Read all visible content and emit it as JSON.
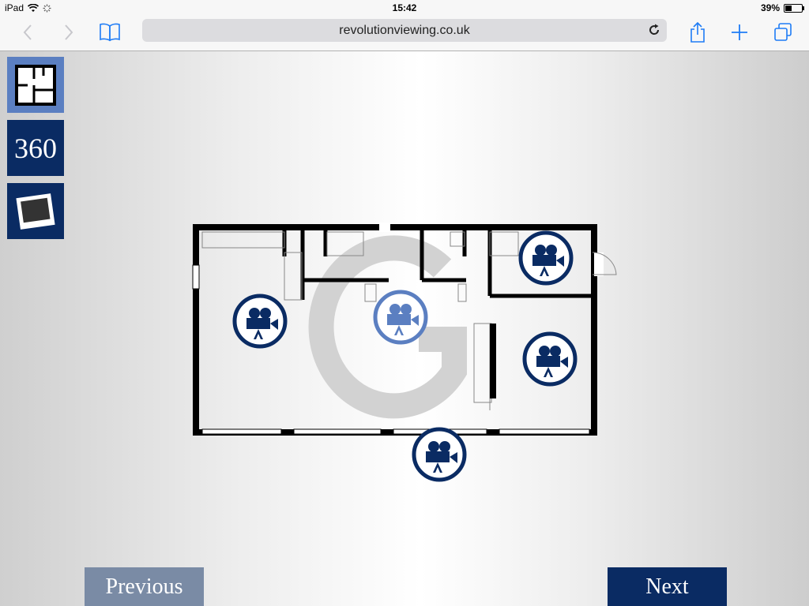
{
  "statusbar": {
    "device": "iPad",
    "time": "15:42",
    "battery_text": "39%",
    "battery_level": 0.39
  },
  "browser": {
    "url": "revolutionviewing.co.uk"
  },
  "icons": {
    "back": "chevron-left-icon",
    "forward": "chevron-right-icon",
    "bookmarks": "book-icon",
    "reload": "reload-icon",
    "share": "share-icon",
    "new_tab": "plus-icon",
    "tabs": "tabs-icon"
  },
  "sidebar": {
    "floorplan": "floorplan-icon",
    "pano_label": "360",
    "photo": "photo-icon"
  },
  "nav": {
    "previous_label": "Previous",
    "next_label": "Next"
  },
  "colors": {
    "navy": "#0a2b63",
    "light_blue": "#5b7fc1",
    "previous_bg": "#7a8ba5",
    "ios_blue": "#1e7cf6"
  }
}
